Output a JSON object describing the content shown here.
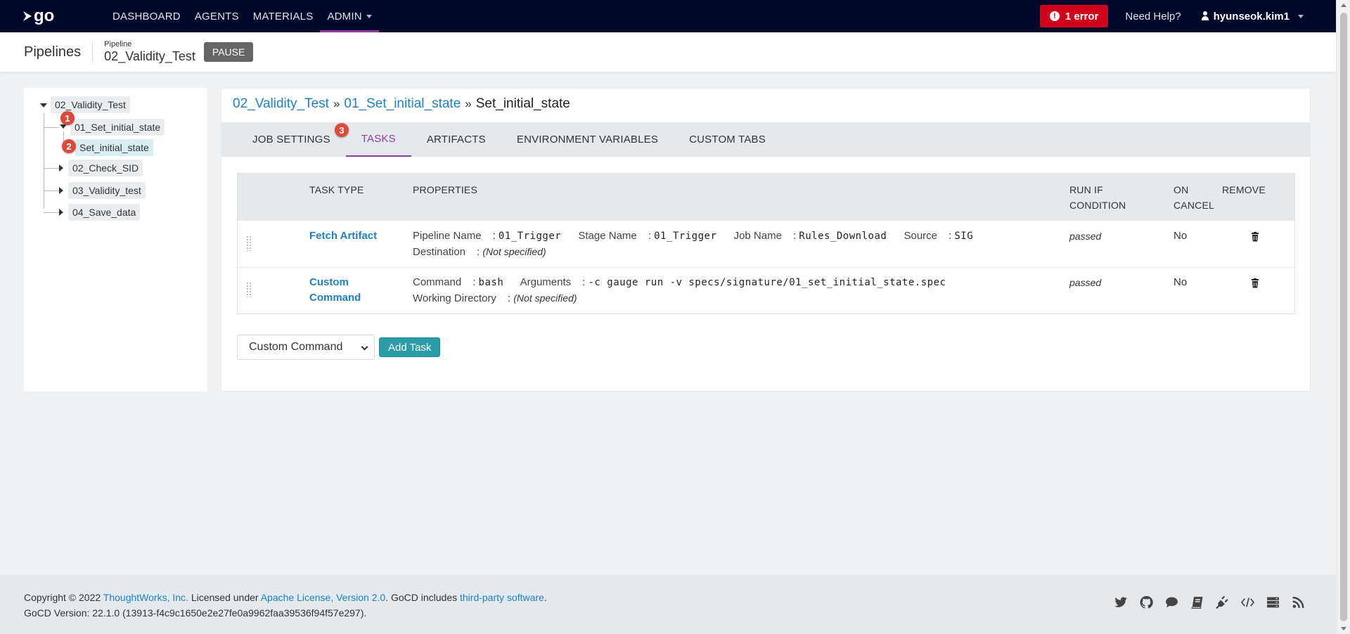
{
  "topnav": {
    "logo_text": "go",
    "links": [
      "DASHBOARD",
      "AGENTS",
      "MATERIALS",
      "ADMIN"
    ],
    "error_label": "1 error",
    "help_label": "Need Help?",
    "user_name": "hyunseok.kim1"
  },
  "header": {
    "title": "Pipelines",
    "pipeline_label": "Pipeline",
    "pipeline_name": "02_Validity_Test",
    "pause_label": "PAUSE"
  },
  "tree": {
    "root": "02_Validity_Test",
    "stages": [
      "01_Set_initial_state",
      "02_Check_SID",
      "03_Validity_test",
      "04_Save_data"
    ],
    "job": "Set_initial_state",
    "badges": [
      "1",
      "2",
      "3"
    ]
  },
  "breadcrumb": {
    "pipeline": "02_Validity_Test",
    "stage": "01_Set_initial_state",
    "job": "Set_initial_state",
    "separator": "»"
  },
  "tabs": [
    "JOB SETTINGS",
    "TASKS",
    "ARTIFACTS",
    "ENVIRONMENT VARIABLES",
    "CUSTOM TABS"
  ],
  "table": {
    "headers": {
      "task_type": "TASK TYPE",
      "properties": "PROPERTIES",
      "run_if_1": "RUN IF",
      "run_if_2": "CONDITION",
      "on_cancel_1": "ON",
      "on_cancel_2": "CANCEL",
      "remove": "REMOVE"
    },
    "rows": [
      {
        "type": "Fetch Artifact",
        "props": {
          "pipeline_name_key": "Pipeline Name",
          "pipeline_name_val": "01_Trigger",
          "stage_name_key": "Stage Name",
          "stage_name_val": "01_Trigger",
          "job_name_key": "Job Name",
          "job_name_val": "Rules_Download",
          "source_key": "Source",
          "source_val": "SIG",
          "destination_key": "Destination",
          "destination_val": "(Not specified)"
        },
        "run_if": "passed",
        "on_cancel": "No"
      },
      {
        "type_line1": "Custom",
        "type_line2": "Command",
        "props": {
          "command_key": "Command",
          "command_val": "bash",
          "arguments_key": "Arguments",
          "arguments_val": "-c gauge run -v specs/signature/01_set_initial_state.spec",
          "workdir_key": "Working Directory",
          "workdir_val": "(Not specified)"
        },
        "run_if": "passed",
        "on_cancel": "No"
      }
    ],
    "colon": ":"
  },
  "add_task": {
    "selected": "Custom Command",
    "button": "Add Task"
  },
  "footer": {
    "copyright": "Copyright © 2022",
    "company": "ThoughtWorks, Inc.",
    "licensed": "Licensed under",
    "license": "Apache License, Version 2.0",
    "includes": ". GoCD includes",
    "third_party": "third-party software",
    "period": ".",
    "version": "GoCD Version: 22.1.0 (13913-f4c9c1650e2e27fe0a9962faa39536f94f57e297)."
  },
  "icons": {
    "footer": [
      "twitter-icon",
      "github-icon",
      "chat-icon",
      "book-icon",
      "plugin-icon",
      "code-icon",
      "server-icon",
      "rss-icon"
    ],
    "colors": {
      "nav_bg": "#000728",
      "accent": "#943a9e",
      "link": "#2080be",
      "error": "#d0021b",
      "badge": "#dc4a3c",
      "add_button": "#2a9ca6"
    }
  }
}
